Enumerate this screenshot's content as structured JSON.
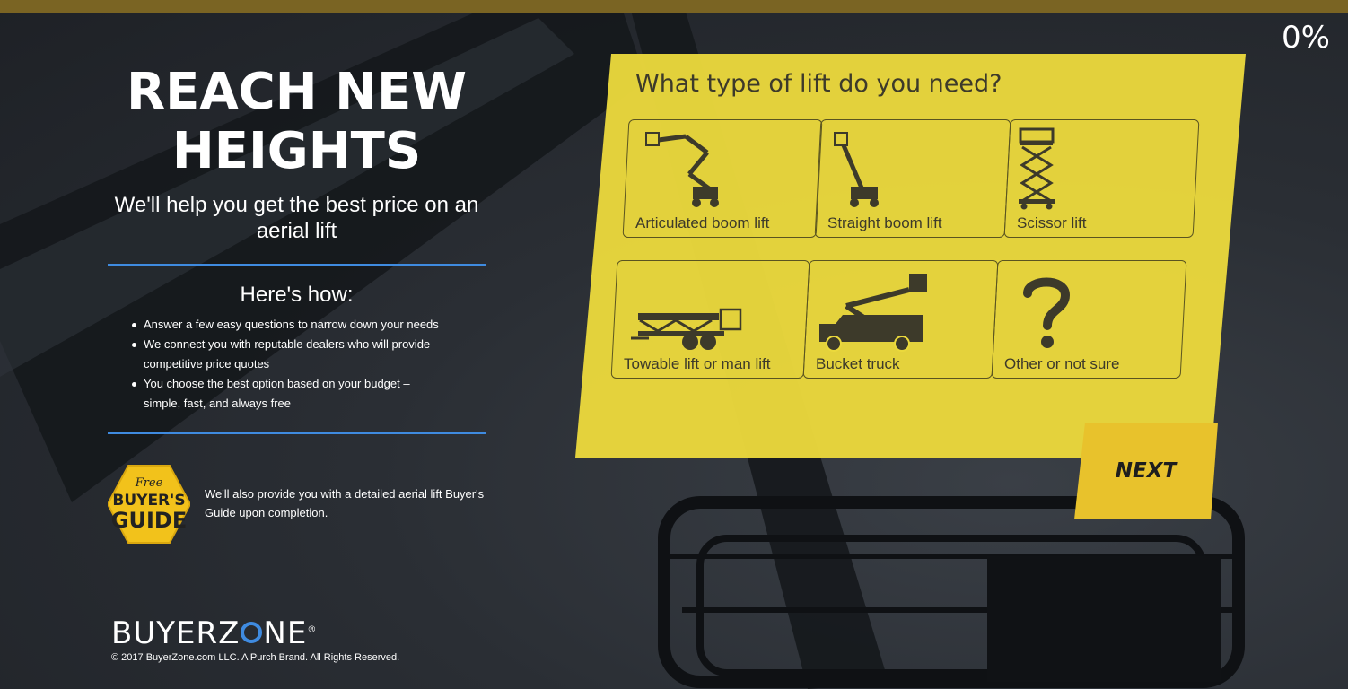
{
  "progress": {
    "percent_label": "0%",
    "fraction": 0.0
  },
  "hero": {
    "title_line1": "REACH NEW",
    "title_line2": "HEIGHTS",
    "subtitle": "We'll help you get the best price on an aerial lift"
  },
  "howto": {
    "heading": "Here's how:",
    "steps": [
      "Answer a few easy questions to narrow down your needs",
      "We connect you with reputable dealers who will provide competitive price quotes",
      "You choose the best option based on your budget – simple, fast, and always free"
    ]
  },
  "guide": {
    "badge_line1": "Free",
    "badge_line2": "BUYER'S",
    "badge_line3": "GUIDE",
    "text": "We'll also provide you with a detailed aerial lift Buyer's Guide upon completion."
  },
  "footer": {
    "logo_part1": "BUYERZ",
    "logo_part2": "NE",
    "copyright": "© 2017 BuyerZone.com LLC. A Purch Brand. All Rights Reserved."
  },
  "quiz": {
    "question": "What type of lift do you need?",
    "options": [
      {
        "label": "Articulated boom lift",
        "icon": "articulated-boom-lift-icon"
      },
      {
        "label": "Straight boom lift",
        "icon": "straight-boom-lift-icon"
      },
      {
        "label": "Scissor lift",
        "icon": "scissor-lift-icon"
      },
      {
        "label": "Towable lift or man lift",
        "icon": "towable-lift-icon"
      },
      {
        "label": "Bucket truck",
        "icon": "bucket-truck-icon"
      },
      {
        "label": "Other or not sure",
        "icon": "question-mark-icon"
      }
    ],
    "next_label": "NEXT"
  },
  "colors": {
    "panel_yellow": "#ebd93c",
    "button_yellow": "#e8c22c",
    "rule_blue": "#3f8be0",
    "progress_bar": "#7a6423",
    "background": "#23272d"
  }
}
